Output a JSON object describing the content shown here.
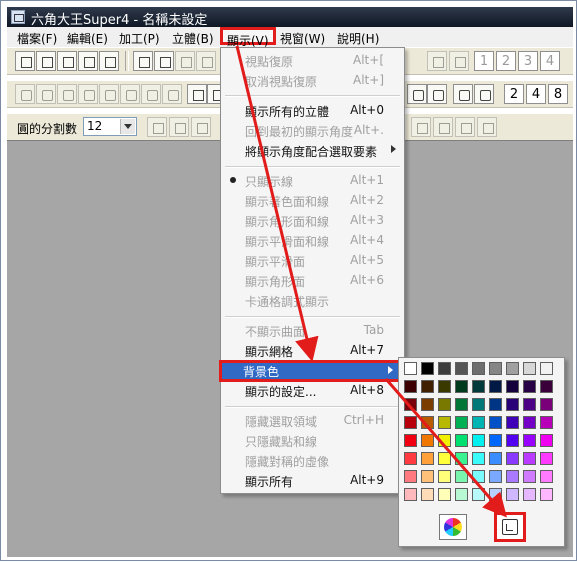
{
  "window": {
    "title": "六角大王Super4 - 名稱未設定"
  },
  "menubar": [
    {
      "label": "檔案(F)"
    },
    {
      "label": "編輯(E)"
    },
    {
      "label": "加工(P)"
    },
    {
      "label": "立體(B)"
    },
    {
      "label": "顯示(V)",
      "active": true
    },
    {
      "label": "視窗(W)"
    },
    {
      "label": "說明(H)"
    }
  ],
  "toolbar": {
    "row1_numbers": [
      "1",
      "2",
      "3",
      "4"
    ],
    "row2_numbers": [
      "2",
      "4",
      "8"
    ],
    "divisions_label": "圓的分割數",
    "divisions_value": "12"
  },
  "view_menu": [
    {
      "label": "視點復原",
      "shortcut": "Alt+[",
      "enabled": false
    },
    {
      "label": "取消視點復原",
      "shortcut": "Alt+]",
      "enabled": false
    },
    {
      "label": "顯示所有的立體",
      "shortcut": "Alt+0",
      "enabled": true
    },
    {
      "label": "回到最初的顯示角度",
      "shortcut": "Alt+.",
      "enabled": false
    },
    {
      "label": "將顯示角度配合選取要素",
      "shortcut": "",
      "enabled": true,
      "submenu": true
    },
    {
      "label": "只顯示線",
      "shortcut": "Alt+1",
      "enabled": false,
      "checked": true
    },
    {
      "label": "顯示著色面和線",
      "shortcut": "Alt+2",
      "enabled": false
    },
    {
      "label": "顯示角形面和線",
      "shortcut": "Alt+3",
      "enabled": false
    },
    {
      "label": "顯示平滑面和線",
      "shortcut": "Alt+4",
      "enabled": false
    },
    {
      "label": "顯示平滑面",
      "shortcut": "Alt+5",
      "enabled": false
    },
    {
      "label": "顯示角形面",
      "shortcut": "Alt+6",
      "enabled": false
    },
    {
      "label": "卡通格調式顯示",
      "shortcut": "",
      "enabled": false
    },
    {
      "label": "不顯示曲面",
      "shortcut": "Tab",
      "enabled": false
    },
    {
      "label": "顯示網格",
      "shortcut": "Alt+7",
      "enabled": true
    },
    {
      "label": "背景色",
      "shortcut": "",
      "enabled": true,
      "submenu": true,
      "highlighted": true
    },
    {
      "label": "顯示的設定...",
      "shortcut": "Alt+8",
      "enabled": true
    },
    {
      "label": "隱藏選取領域",
      "shortcut": "Ctrl+H",
      "enabled": false
    },
    {
      "label": "只隱藏點和線",
      "shortcut": "",
      "enabled": false
    },
    {
      "label": "隱藏對稱的虛像",
      "shortcut": "",
      "enabled": false
    },
    {
      "label": "顯示所有",
      "shortcut": "Alt+9",
      "enabled": true
    }
  ],
  "palette": {
    "colors": [
      [
        "#ffffff",
        "#000000",
        "#3d3d3d",
        "#555555",
        "#6d6d6d",
        "#868686",
        "#a0a0a0",
        "#d7d7d7",
        "#f2f2f2"
      ],
      [
        "#3c0004",
        "#402000",
        "#3a3a00",
        "#003a1c",
        "#003a3a",
        "#001a45",
        "#14003c",
        "#270045",
        "#3a003a"
      ],
      [
        "#790008",
        "#7a3c00",
        "#797900",
        "#007535",
        "#007878",
        "#003585",
        "#2a0079",
        "#4d0085",
        "#790079"
      ],
      [
        "#b8000c",
        "#b85a00",
        "#b8b800",
        "#00b054",
        "#00b4b4",
        "#0050c8",
        "#3f00b8",
        "#7400c8",
        "#b800b8"
      ],
      [
        "#f00010",
        "#f07800",
        "#f0f000",
        "#00e070",
        "#00f0f0",
        "#0068ff",
        "#5400f0",
        "#9800ff",
        "#f000f0"
      ],
      [
        "#ff3a40",
        "#ffa03a",
        "#ffff3a",
        "#3af290",
        "#3afafa",
        "#3a8cff",
        "#8a3aff",
        "#bb3aff",
        "#ff3aff"
      ],
      [
        "#ff7a80",
        "#ffc07a",
        "#ffff7a",
        "#7af5ae",
        "#7afafa",
        "#7aa8ff",
        "#a97aff",
        "#d07aff",
        "#ff7aff"
      ],
      [
        "#ffb8bc",
        "#ffdcb8",
        "#ffffb8",
        "#b8f8d2",
        "#b8fafa",
        "#b8d0ff",
        "#cfb8ff",
        "#e6b8ff",
        "#ffb8ff"
      ]
    ]
  },
  "accent": {
    "annotation_red": "#e21b1b",
    "menu_highlight": "#316ac5"
  }
}
